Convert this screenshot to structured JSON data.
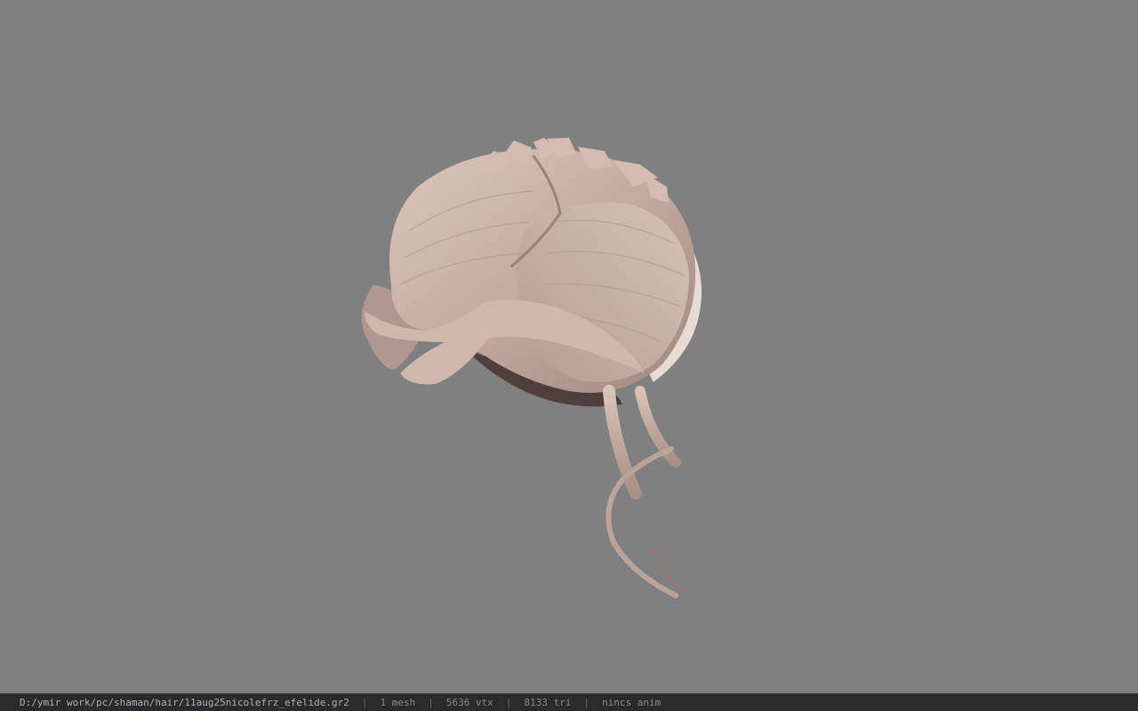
{
  "viewer": {
    "background_color": "#808080",
    "model_subject": "hair-mesh",
    "colors": {
      "hair_base": "#c7aea4",
      "hair_light": "#e0cdc3",
      "hair_dark": "#7a6560",
      "shadow": "#4a3e3a"
    }
  },
  "statusbar": {
    "file_path": "D:/ymir work/pc/shaman/hair/11aug25nicolefrz_efelide.gr2",
    "separator": "|",
    "mesh_count": "1 mesh",
    "vertex_count": "5636 vtx",
    "triangle_count": "8133 tri",
    "anim_status": "nincs anim"
  }
}
